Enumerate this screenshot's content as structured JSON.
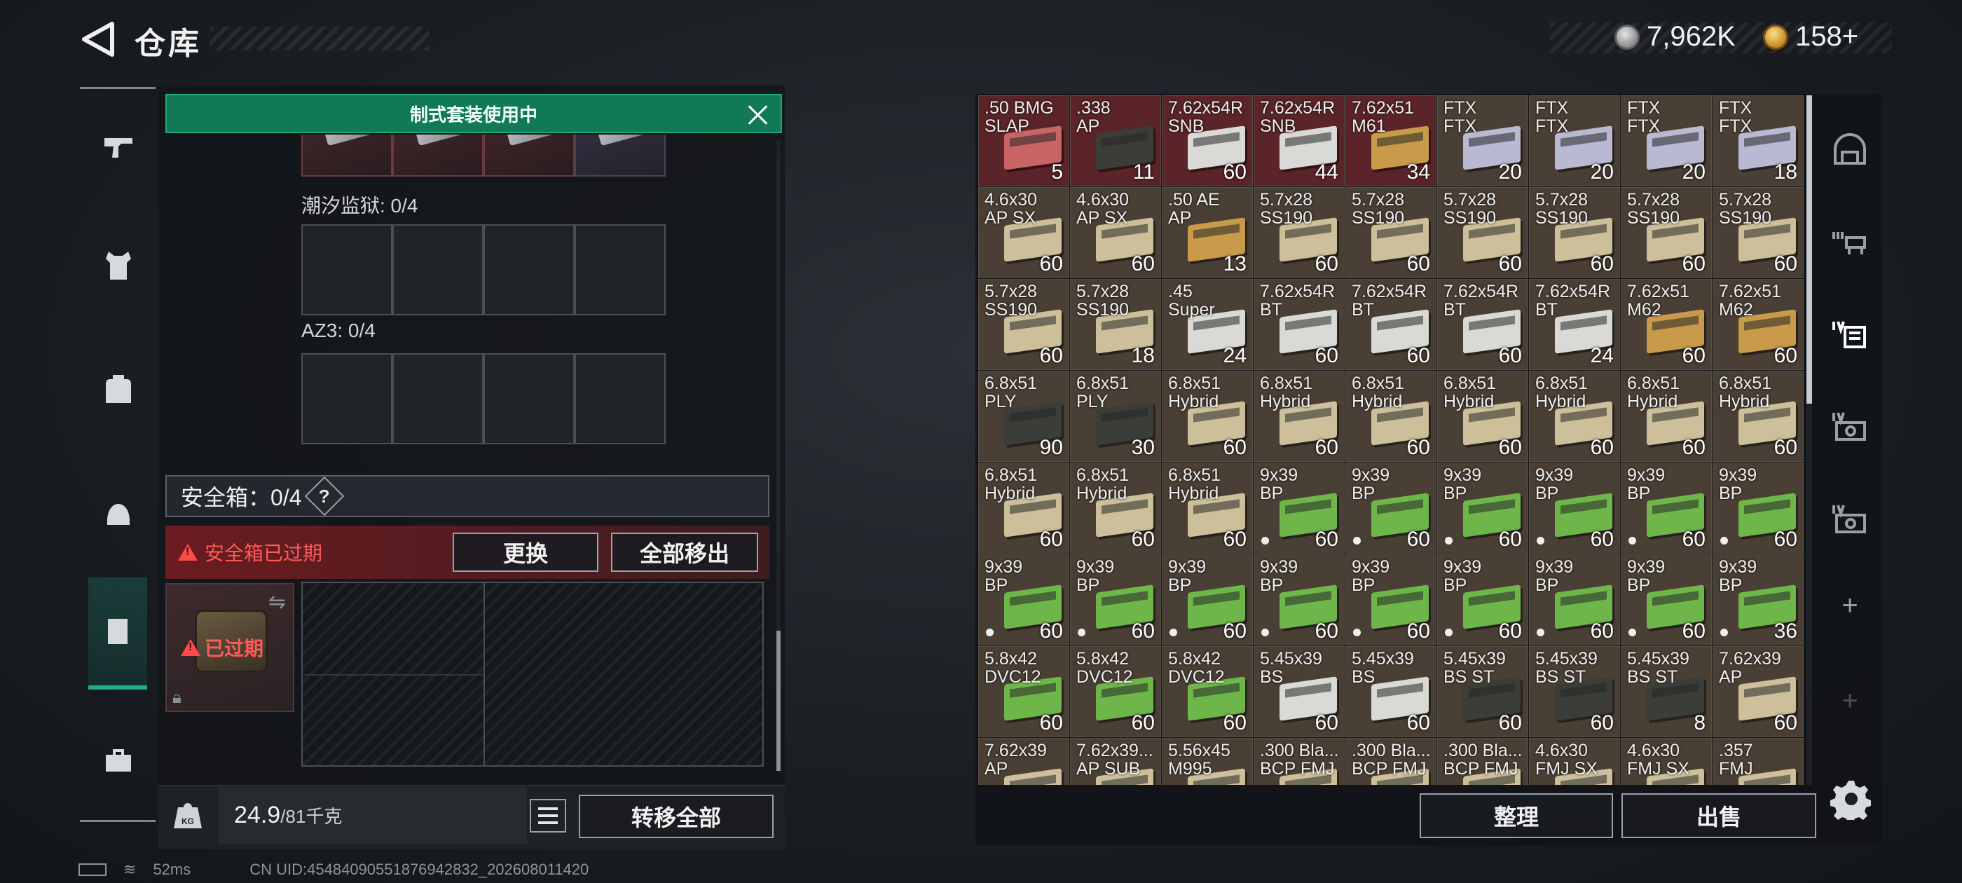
{
  "header": {
    "title": "仓库",
    "silver_amount": "7,962K",
    "gold_amount": "158+"
  },
  "left_panel": {
    "kit_banner": "制式套装使用中",
    "slot_groups": [
      {
        "label": "潮汐监狱: 0/4"
      },
      {
        "label": "AZ3: 0/4"
      }
    ],
    "safe_box": {
      "title": "安全箱：0/4",
      "help": "?",
      "expired_message": "安全箱已过期",
      "item_badge": "已过期",
      "replace_label": "更换",
      "remove_all_label": "全部移出"
    },
    "weight": {
      "current": "24.9",
      "capacity": "/81千克"
    },
    "transfer_all_label": "转移全部"
  },
  "status_bar": {
    "ping": "52ms",
    "uid": "CN UID:45484090551876942832_202608011420"
  },
  "inventory": {
    "colors": {
      "red": "#5a2428",
      "brown": "#4a3f35",
      "box_white": "#d9d9d6",
      "box_tan": "#cdbf99",
      "box_gold": "#c89a4a",
      "box_green": "#6fb64a",
      "box_lavender": "#b9b9d3",
      "box_dark": "#3b3d38",
      "box_pink": "#c86464"
    },
    "rows": [
      [
        {
          "name": ".50 BMG\nSLAP",
          "count": "5",
          "bg": "red",
          "box": "box_pink"
        },
        {
          "name": ".338\nAP",
          "count": "11",
          "bg": "red",
          "box": "box_dark"
        },
        {
          "name": "7.62x54R\nSNB",
          "count": "60",
          "bg": "red",
          "box": "box_white"
        },
        {
          "name": "7.62x54R\nSNB",
          "count": "44",
          "bg": "red",
          "box": "box_white"
        },
        {
          "name": "7.62x51\nM61",
          "count": "34",
          "bg": "red",
          "box": "box_gold"
        },
        {
          "name": "FTX\nFTX",
          "count": "20",
          "bg": "brown",
          "box": "box_lavender"
        },
        {
          "name": "FTX\nFTX",
          "count": "20",
          "bg": "brown",
          "box": "box_lavender"
        },
        {
          "name": "FTX\nFTX",
          "count": "20",
          "bg": "brown",
          "box": "box_lavender"
        },
        {
          "name": "FTX\nFTX",
          "count": "18",
          "bg": "brown",
          "box": "box_lavender"
        }
      ],
      [
        {
          "name": "4.6x30\nAP SX",
          "count": "60",
          "bg": "brown",
          "box": "box_tan"
        },
        {
          "name": "4.6x30\nAP SX",
          "count": "60",
          "bg": "brown",
          "box": "box_tan"
        },
        {
          "name": ".50 AE\nAP",
          "count": "13",
          "bg": "brown",
          "box": "box_gold"
        },
        {
          "name": "5.7x28\nSS190",
          "count": "60",
          "bg": "brown",
          "box": "box_tan"
        },
        {
          "name": "5.7x28\nSS190",
          "count": "60",
          "bg": "brown",
          "box": "box_tan"
        },
        {
          "name": "5.7x28\nSS190",
          "count": "60",
          "bg": "brown",
          "box": "box_tan"
        },
        {
          "name": "5.7x28\nSS190",
          "count": "60",
          "bg": "brown",
          "box": "box_tan"
        },
        {
          "name": "5.7x28\nSS190",
          "count": "60",
          "bg": "brown",
          "box": "box_tan"
        },
        {
          "name": "5.7x28\nSS190",
          "count": "60",
          "bg": "brown",
          "box": "box_tan"
        }
      ],
      [
        {
          "name": "5.7x28\nSS190",
          "count": "60",
          "bg": "brown",
          "box": "box_tan"
        },
        {
          "name": "5.7x28\nSS190",
          "count": "18",
          "bg": "brown",
          "box": "box_tan"
        },
        {
          "name": ".45\nSuper",
          "count": "24",
          "bg": "brown",
          "box": "box_white"
        },
        {
          "name": "7.62x54R\nBT",
          "count": "60",
          "bg": "brown",
          "box": "box_white"
        },
        {
          "name": "7.62x54R\nBT",
          "count": "60",
          "bg": "brown",
          "box": "box_white"
        },
        {
          "name": "7.62x54R\nBT",
          "count": "60",
          "bg": "brown",
          "box": "box_white"
        },
        {
          "name": "7.62x54R\nBT",
          "count": "24",
          "bg": "brown",
          "box": "box_white"
        },
        {
          "name": "7.62x51\nM62",
          "count": "60",
          "bg": "brown",
          "box": "box_gold"
        },
        {
          "name": "7.62x51\nM62",
          "count": "60",
          "bg": "brown",
          "box": "box_gold"
        }
      ],
      [
        {
          "name": "6.8x51\nPLY",
          "count": "90",
          "bg": "brown",
          "box": "box_dark"
        },
        {
          "name": "6.8x51\nPLY",
          "count": "30",
          "bg": "brown",
          "box": "box_dark"
        },
        {
          "name": "6.8x51\nHybrid",
          "count": "60",
          "bg": "brown",
          "box": "box_tan"
        },
        {
          "name": "6.8x51\nHybrid",
          "count": "60",
          "bg": "brown",
          "box": "box_tan"
        },
        {
          "name": "6.8x51\nHybrid",
          "count": "60",
          "bg": "brown",
          "box": "box_tan"
        },
        {
          "name": "6.8x51\nHybrid",
          "count": "60",
          "bg": "brown",
          "box": "box_tan"
        },
        {
          "name": "6.8x51\nHybrid",
          "count": "60",
          "bg": "brown",
          "box": "box_tan"
        },
        {
          "name": "6.8x51\nHybrid",
          "count": "60",
          "bg": "brown",
          "box": "box_tan"
        },
        {
          "name": "6.8x51\nHybrid",
          "count": "60",
          "bg": "brown",
          "box": "box_tan"
        }
      ],
      [
        {
          "name": "6.8x51\nHybrid",
          "count": "60",
          "bg": "brown",
          "box": "box_tan"
        },
        {
          "name": "6.8x51\nHybrid",
          "count": "60",
          "bg": "brown",
          "box": "box_tan"
        },
        {
          "name": "6.8x51\nHybrid",
          "count": "60",
          "bg": "brown",
          "box": "box_tan"
        },
        {
          "name": "9x39\nBP",
          "count": "60",
          "bg": "brown",
          "box": "box_green",
          "dot": true
        },
        {
          "name": "9x39\nBP",
          "count": "60",
          "bg": "brown",
          "box": "box_green",
          "dot": true
        },
        {
          "name": "9x39\nBP",
          "count": "60",
          "bg": "brown",
          "box": "box_green",
          "dot": true
        },
        {
          "name": "9x39\nBP",
          "count": "60",
          "bg": "brown",
          "box": "box_green",
          "dot": true
        },
        {
          "name": "9x39\nBP",
          "count": "60",
          "bg": "brown",
          "box": "box_green",
          "dot": true
        },
        {
          "name": "9x39\nBP",
          "count": "60",
          "bg": "brown",
          "box": "box_green",
          "dot": true
        }
      ],
      [
        {
          "name": "9x39\nBP",
          "count": "60",
          "bg": "brown",
          "box": "box_green",
          "dot": true
        },
        {
          "name": "9x39\nBP",
          "count": "60",
          "bg": "brown",
          "box": "box_green",
          "dot": true
        },
        {
          "name": "9x39\nBP",
          "count": "60",
          "bg": "brown",
          "box": "box_green",
          "dot": true
        },
        {
          "name": "9x39\nBP",
          "count": "60",
          "bg": "brown",
          "box": "box_green",
          "dot": true
        },
        {
          "name": "9x39\nBP",
          "count": "60",
          "bg": "brown",
          "box": "box_green",
          "dot": true
        },
        {
          "name": "9x39\nBP",
          "count": "60",
          "bg": "brown",
          "box": "box_green",
          "dot": true
        },
        {
          "name": "9x39\nBP",
          "count": "60",
          "bg": "brown",
          "box": "box_green",
          "dot": true
        },
        {
          "name": "9x39\nBP",
          "count": "60",
          "bg": "brown",
          "box": "box_green",
          "dot": true
        },
        {
          "name": "9x39\nBP",
          "count": "36",
          "bg": "brown",
          "box": "box_green",
          "dot": true
        }
      ],
      [
        {
          "name": "5.8x42\nDVC12",
          "count": "60",
          "bg": "brown",
          "box": "box_green"
        },
        {
          "name": "5.8x42\nDVC12",
          "count": "60",
          "bg": "brown",
          "box": "box_green"
        },
        {
          "name": "5.8x42\nDVC12",
          "count": "60",
          "bg": "brown",
          "box": "box_green"
        },
        {
          "name": "5.45x39\nBS",
          "count": "60",
          "bg": "brown",
          "box": "box_white"
        },
        {
          "name": "5.45x39\nBS",
          "count": "60",
          "bg": "brown",
          "box": "box_white"
        },
        {
          "name": "5.45x39\nBS ST",
          "count": "60",
          "bg": "brown",
          "box": "box_dark"
        },
        {
          "name": "5.45x39\nBS ST",
          "count": "60",
          "bg": "brown",
          "box": "box_dark"
        },
        {
          "name": "5.45x39\nBS ST",
          "count": "8",
          "bg": "brown",
          "box": "box_dark"
        },
        {
          "name": "7.62x39\nAP",
          "count": "60",
          "bg": "brown",
          "box": "box_tan"
        }
      ],
      [
        {
          "name": "7.62x39\nAP",
          "count": "",
          "bg": "brown",
          "box": "box_tan"
        },
        {
          "name": "7.62x39...\nAP SUB",
          "count": "",
          "bg": "brown",
          "box": "box_tan"
        },
        {
          "name": "5.56x45\nM995",
          "count": "",
          "bg": "brown",
          "box": "box_tan"
        },
        {
          "name": ".300 Bla...\nBCP FMJ",
          "count": "",
          "bg": "brown",
          "box": "box_tan"
        },
        {
          "name": ".300 Bla...\nBCP FMJ",
          "count": "",
          "bg": "brown",
          "box": "box_tan"
        },
        {
          "name": ".300 Bla...\nBCP FMJ",
          "count": "",
          "bg": "brown",
          "box": "box_tan"
        },
        {
          "name": "4.6x30\nFMJ SX",
          "count": "",
          "bg": "brown",
          "box": "box_tan"
        },
        {
          "name": "4.6x30\nFMJ SX",
          "count": "",
          "bg": "brown",
          "box": "box_tan"
        },
        {
          "name": ".357\nFMJ",
          "count": "",
          "bg": "brown",
          "box": "box_tan"
        }
      ]
    ],
    "sort_label": "整理",
    "sell_label": "出售"
  },
  "right_tabs": [
    {
      "icon": "dome-icon"
    },
    {
      "icon": "vest-level-3-icon"
    },
    {
      "icon": "case-level-4-icon"
    },
    {
      "icon": "safe-level-4-icon"
    },
    {
      "icon": "safe-level-4b-icon"
    },
    {
      "icon": "add-icon"
    },
    {
      "icon": "add-icon"
    }
  ]
}
